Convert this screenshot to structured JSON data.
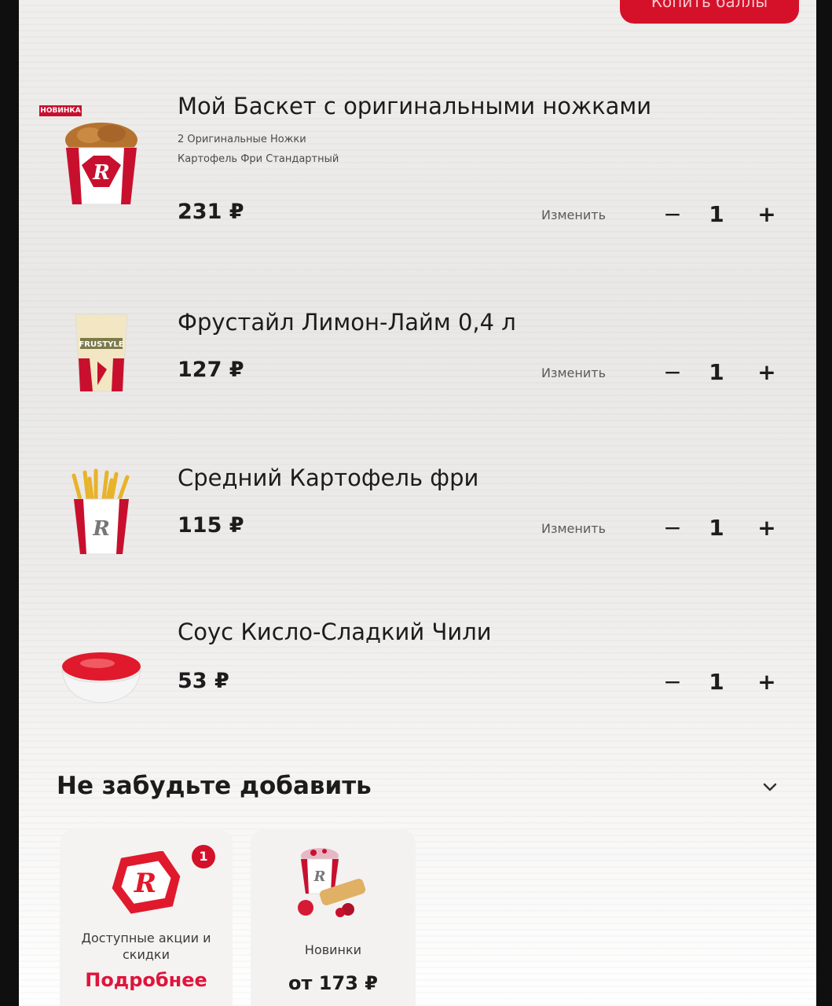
{
  "header": {
    "top_button_label": "Копить баллы"
  },
  "cart": {
    "items": [
      {
        "name": "Мой Баскет с оригинальными ножками",
        "badge": "НОВИНКА",
        "details": [
          "2 Оригинальные Ножки",
          "Картофель Фри Стандартный"
        ],
        "price": "231 ₽",
        "change_label": "Изменить",
        "minus": "−",
        "quantity": "1",
        "plus": "+"
      },
      {
        "name": "Фрустайл Лимон-Лайм 0,4 л",
        "price": "127 ₽",
        "change_label": "Изменить",
        "minus": "−",
        "quantity": "1",
        "plus": "+"
      },
      {
        "name": "Средний Картофель фри",
        "price": "115 ₽",
        "change_label": "Изменить",
        "minus": "−",
        "quantity": "1",
        "plus": "+"
      },
      {
        "name": "Соус Кисло-Сладкий Чили",
        "price": "53 ₽",
        "minus": "−",
        "quantity": "1",
        "plus": "+"
      }
    ]
  },
  "suggestions": {
    "title": "Не забудьте добавить",
    "cards": [
      {
        "label_line1": "Доступные акции и",
        "label_line2": "скидки",
        "link": "Подробнее",
        "badge_count": "1",
        "icon": "rostics-logo-icon"
      },
      {
        "label": "Новинки",
        "price": "от 173 ₽",
        "icon": "new-products-icon"
      }
    ]
  },
  "colors": {
    "accent_red": "#d5112a",
    "link_pink": "#e0143c"
  }
}
